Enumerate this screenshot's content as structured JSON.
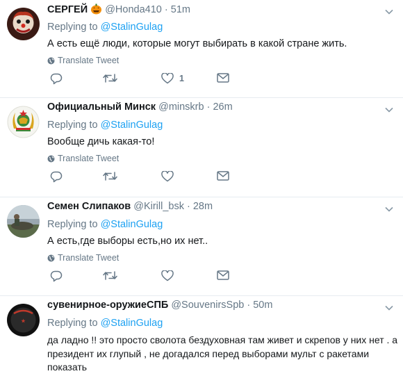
{
  "tweets": [
    {
      "name": "СЕРГЕЙ",
      "emoji": "jack-o-lantern-icon",
      "handle": "@Honda410",
      "dot": "·",
      "time": "51m",
      "replying_prefix": "Replying to",
      "replying_to": "@StalinGulag",
      "text": "А есть ещё люди, которые могут выбирать в какой стране жить.",
      "translate": "Translate Tweet",
      "likes": "1"
    },
    {
      "name": "Официальный Минск",
      "handle": "@minskrb",
      "dot": "·",
      "time": "26m",
      "replying_prefix": "Replying to",
      "replying_to": "@StalinGulag",
      "text": "Вообще дичь какая-то!",
      "translate": "Translate Tweet"
    },
    {
      "name": "Семен Слипаков",
      "handle": "@Kirill_bsk",
      "dot": "·",
      "time": "28m",
      "replying_prefix": "Replying to",
      "replying_to": "@StalinGulag",
      "text": "А есть,где выборы есть,но их нет..",
      "translate": "Translate Tweet"
    },
    {
      "name": "сувенирное-оружиеСПБ",
      "handle": "@SouvenirsSpb",
      "dot": "·",
      "time": "50m",
      "replying_prefix": "Replying to",
      "replying_to": "@StalinGulag",
      "text": "да ладно !! это просто сволота бездуховная там живет и скрепов у них нет . а президент их глупый , не догадался перед выборами мульт с ракетами показать"
    }
  ],
  "colors": {
    "link": "#1da1f2",
    "muted": "#657786",
    "divider": "#e6ecf0"
  }
}
